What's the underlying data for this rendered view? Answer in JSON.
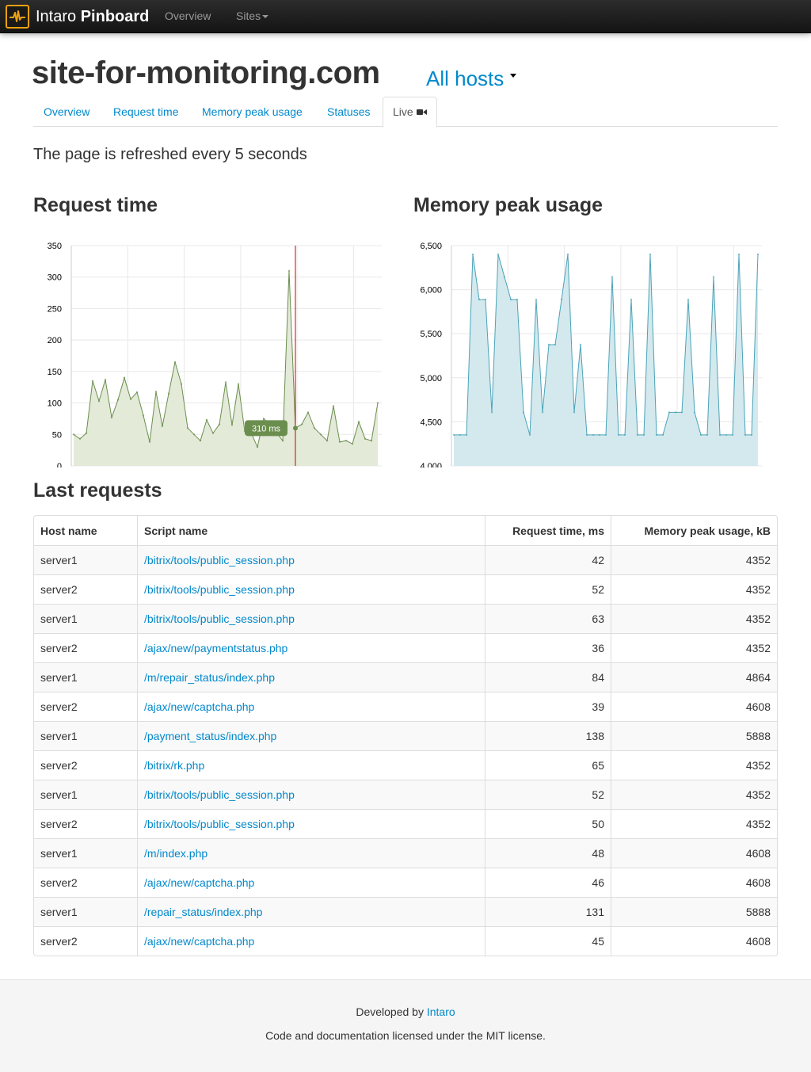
{
  "navbar": {
    "brand_light": "Intaro",
    "brand_bold": "Pinboard",
    "links": {
      "overview": "Overview",
      "sites": "Sites"
    }
  },
  "header": {
    "site_title": "site-for-monitoring.com",
    "hosts_dropdown": "All hosts"
  },
  "tabs": [
    "Overview",
    "Request time",
    "Memory peak usage",
    "Statuses",
    "Live"
  ],
  "active_tab": "Live",
  "refresh_note": "The page is refreshed every 5 seconds",
  "sections": {
    "request_time": "Request time",
    "memory_peak": "Memory peak usage",
    "last_requests": "Last requests"
  },
  "chart_data": [
    {
      "type": "area",
      "title": "Request time",
      "ylim": [
        0,
        350
      ],
      "yticks": [
        "0",
        "50",
        "100",
        "150",
        "200",
        "250",
        "300",
        "350"
      ],
      "grid": true,
      "color": "#6b8e4e",
      "fill": "#e3ead8",
      "tooltip": "310 ms",
      "highlight_index": 35,
      "values": [
        50,
        43,
        52,
        135,
        103,
        137,
        77,
        105,
        140,
        106,
        117,
        80,
        38,
        118,
        63,
        115,
        165,
        130,
        60,
        50,
        40,
        73,
        52,
        66,
        133,
        65,
        130,
        55,
        53,
        30,
        75,
        65,
        53,
        40,
        310,
        60,
        66,
        85,
        60,
        50,
        40,
        95,
        38,
        40,
        35,
        70,
        43,
        40,
        100
      ]
    },
    {
      "type": "area",
      "title": "Memory peak usage",
      "ylim": [
        4000,
        6500
      ],
      "yticks": [
        "4,000",
        "4,500",
        "5,000",
        "5,500",
        "6,000",
        "6,500"
      ],
      "grid": true,
      "color": "#4ba3b8",
      "fill": "#d3e9ee",
      "values": [
        4352,
        4352,
        4352,
        6400,
        5888,
        5888,
        4608,
        6400,
        6144,
        5888,
        5888,
        4608,
        4352,
        5888,
        4608,
        5376,
        5376,
        5888,
        6400,
        4608,
        5376,
        4352,
        4352,
        4352,
        4352,
        6144,
        4352,
        4352,
        5888,
        4352,
        4352,
        6400,
        4352,
        4352,
        4608,
        4608,
        4608,
        5888,
        4608,
        4352,
        4352,
        6144,
        4352,
        4352,
        4352,
        6400,
        4352,
        4352,
        6400
      ]
    }
  ],
  "table": {
    "columns": [
      "Host name",
      "Script name",
      "Request time, ms",
      "Memory peak usage, kB"
    ],
    "rows": [
      [
        "server1",
        "/bitrix/tools/public_session.php",
        "42",
        "4352"
      ],
      [
        "server2",
        "/bitrix/tools/public_session.php",
        "52",
        "4352"
      ],
      [
        "server1",
        "/bitrix/tools/public_session.php",
        "63",
        "4352"
      ],
      [
        "server2",
        "/ajax/new/paymentstatus.php",
        "36",
        "4352"
      ],
      [
        "server1",
        "/m/repair_status/index.php",
        "84",
        "4864"
      ],
      [
        "server2",
        "/ajax/new/captcha.php",
        "39",
        "4608"
      ],
      [
        "server1",
        "/payment_status/index.php",
        "138",
        "5888"
      ],
      [
        "server2",
        "/bitrix/rk.php",
        "65",
        "4352"
      ],
      [
        "server1",
        "/bitrix/tools/public_session.php",
        "52",
        "4352"
      ],
      [
        "server2",
        "/bitrix/tools/public_session.php",
        "50",
        "4352"
      ],
      [
        "server1",
        "/m/index.php",
        "48",
        "4608"
      ],
      [
        "server2",
        "/ajax/new/captcha.php",
        "46",
        "4608"
      ],
      [
        "server1",
        "/repair_status/index.php",
        "131",
        "5888"
      ],
      [
        "server2",
        "/ajax/new/captcha.php",
        "45",
        "4608"
      ]
    ]
  },
  "footer": {
    "developed_by": "Developed by",
    "developer_link": "Intaro",
    "license": "Code and documentation licensed under the MIT license."
  }
}
